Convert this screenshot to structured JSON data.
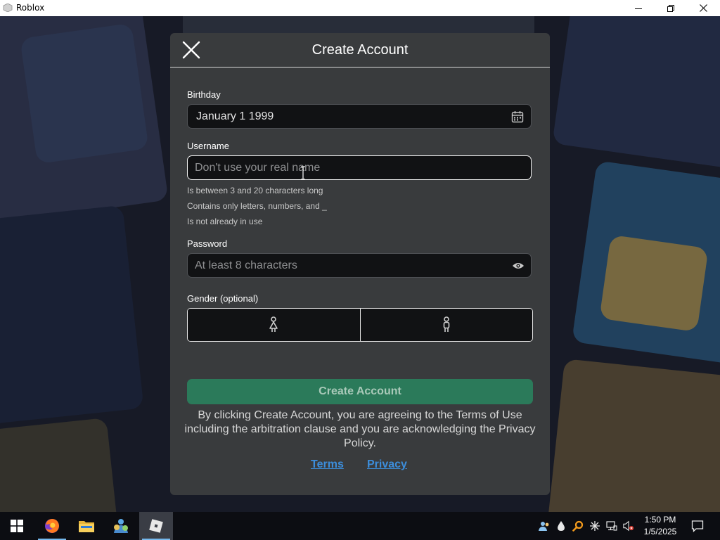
{
  "window": {
    "title": "Roblox",
    "icon": "roblox-app-icon",
    "controls": [
      "minimize-icon",
      "restore-icon",
      "close-icon"
    ]
  },
  "modal": {
    "title": "Create Account",
    "close_icon": "close-x-icon",
    "birthday": {
      "label": "Birthday",
      "value": "January 1 1999",
      "icon": "calendar-icon"
    },
    "username": {
      "label": "Username",
      "placeholder": "Don't use your real name",
      "value": "",
      "hints": [
        "Is between 3 and 20 characters long",
        "Contains only letters, numbers, and _",
        "Is not already in use"
      ]
    },
    "password": {
      "label": "Password",
      "placeholder": "At least 8 characters",
      "icon": "eye-icon"
    },
    "gender": {
      "label": "Gender (optional)",
      "options": [
        "female-icon",
        "male-icon"
      ]
    },
    "create_button": "Create Account",
    "legal_text": "By clicking Create Account, you are agreeing to the Terms of Use including the arbitration clause and you are acknowledging the Privacy Policy.",
    "terms_link": "Terms",
    "privacy_link": "Privacy"
  },
  "taskbar": {
    "apps": [
      "windows-start-icon",
      "firefox-icon",
      "file-explorer-icon",
      "app-icon",
      "roblox-icon"
    ],
    "tray": [
      "people-icon",
      "dropbox-icon",
      "magnifier-icon",
      "network-status-icon",
      "network-icon",
      "volume-muted-icon"
    ],
    "time": "1:50 PM",
    "date": "1/5/2025",
    "notification_icon": "action-center-icon"
  },
  "colors": {
    "modal_bg": "#393b3d",
    "field_bg": "#111214",
    "create_button_bg": "#2b7a5a",
    "link": "#3c8ddb",
    "taskbar_bg": "#0c0d12"
  }
}
